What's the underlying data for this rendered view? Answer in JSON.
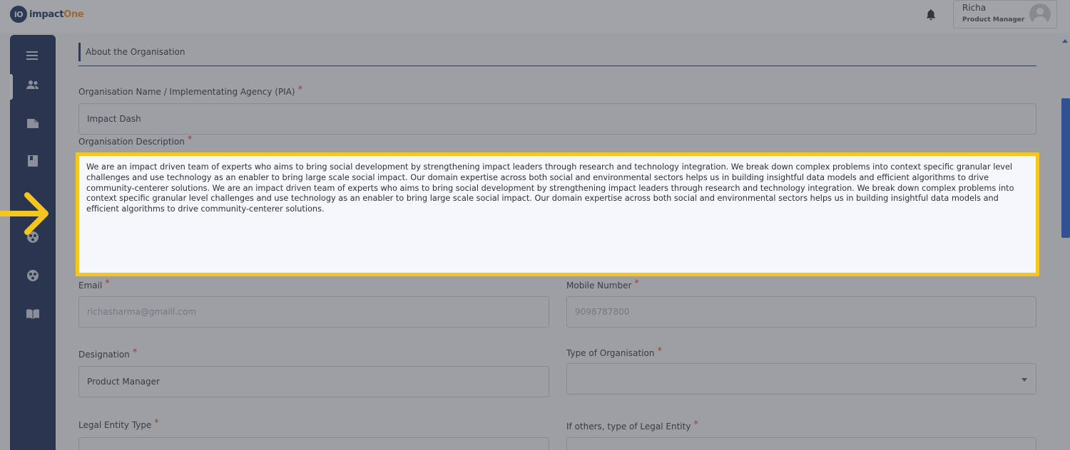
{
  "app": {
    "logo_mark": "iO",
    "logo_name": "impact",
    "logo_accent": "One"
  },
  "header": {
    "user_name": "Richa",
    "user_role": "Product Manager"
  },
  "sidebar": {
    "items": [
      "menu-icon",
      "users-icon",
      "folder-icon",
      "book-icon",
      "arrow-icon",
      "globe-icon",
      "globe-icon",
      "open-book-icon"
    ]
  },
  "form": {
    "section_title": "About the Organisation",
    "org_name_label": "Organisation Name / Implementating Agency (PIA)",
    "org_name_value": "Impact Dash",
    "org_desc_label": "Organisation Description",
    "org_desc_value": "We are an impact driven team of experts who aims to bring social development by strengthening impact leaders through research and technology integration. We break down complex problems into context specific granular level challenges and use technology as an enabler to bring large scale social impact. Our domain expertise across both social and environmental sectors helps us in building insightful data models and efficient algorithms to drive community-centerer solutions. We are an impact driven team of experts who aims to bring social development by strengthening impact leaders through research and technology integration. We break down complex problems into context specific granular level challenges and use technology as an enabler to bring large scale social impact. Our domain expertise across both social and environmental sectors helps us in building insightful data models and efficient algorithms to drive community-centerer solutions.",
    "email_label": "Email",
    "email_placeholder": "richasharma@gmaill.com",
    "mobile_label": "Mobile Number",
    "mobile_placeholder": "9098787800",
    "designation_label": "Designation",
    "designation_value": "Product Manager",
    "org_type_label": "Type of Organisation",
    "org_type_value": "",
    "legal_entity_label": "Legal Entity Type",
    "legal_entity_other_label": "If others, type of Legal Entity",
    "required_mark": "*"
  },
  "colors": {
    "highlight": "#f6c51f",
    "sidebar": "#0f2450",
    "accent": "#1c5bd6",
    "required": "#e53935"
  }
}
